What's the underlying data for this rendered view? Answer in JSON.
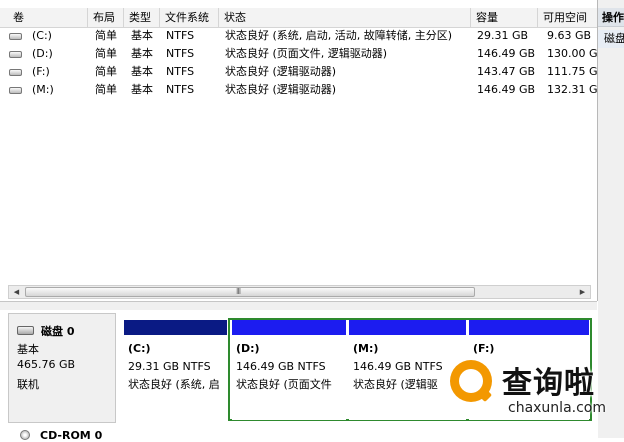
{
  "volume_list": {
    "columns": [
      "卷",
      "布局",
      "类型",
      "文件系统",
      "状态",
      "容量",
      "可用空间"
    ],
    "rows": [
      {
        "volume": "(C:)",
        "layout": "简单",
        "type": "基本",
        "fs": "NTFS",
        "status": "状态良好 (系统, 启动, 活动, 故障转储, 主分区)",
        "capacity": "29.31 GB",
        "free": "9.63 GB"
      },
      {
        "volume": "(D:)",
        "layout": "简单",
        "type": "基本",
        "fs": "NTFS",
        "status": "状态良好 (页面文件, 逻辑驱动器)",
        "capacity": "146.49 GB",
        "free": "130.00 GB"
      },
      {
        "volume": "(F:)",
        "layout": "简单",
        "type": "基本",
        "fs": "NTFS",
        "status": "状态良好 (逻辑驱动器)",
        "capacity": "143.47 GB",
        "free": "111.75 GB"
      },
      {
        "volume": "(M:)",
        "layout": "简单",
        "type": "基本",
        "fs": "NTFS",
        "status": "状态良好 (逻辑驱动器)",
        "capacity": "146.49 GB",
        "free": "132.31 GB"
      }
    ]
  },
  "scrollbar": {
    "grip": "III"
  },
  "action_pane": {
    "title": "操作",
    "item": "磁盘"
  },
  "disk0": {
    "name": "磁盘 0",
    "type": "基本",
    "size": "465.76 GB",
    "state": "联机"
  },
  "partitions": [
    {
      "label": "(C:)",
      "size_fs": "29.31 GB NTFS",
      "status": "状态良好 (系统, 启",
      "bar_color": "#0a1a84"
    },
    {
      "label": "(D:)",
      "size_fs": "146.49 GB NTFS",
      "status": "状态良好 (页面文件",
      "bar_color": "#1c1cf0"
    },
    {
      "label": "(M:)",
      "size_fs": "146.49 GB NTFS",
      "status": "状态良好 (逻辑驱",
      "bar_color": "#1c1cf0"
    },
    {
      "label": "(F:)",
      "size_fs": "",
      "status": "",
      "bar_color": "#1c1cf0"
    }
  ],
  "extended_frame_color": "#2e8a2e",
  "cdrom": {
    "name": "CD-ROM 0"
  },
  "watermark": {
    "title": "查询啦",
    "url": "chaxunla.com",
    "badge_color": "#f39800",
    "badge_letter": "Q"
  }
}
